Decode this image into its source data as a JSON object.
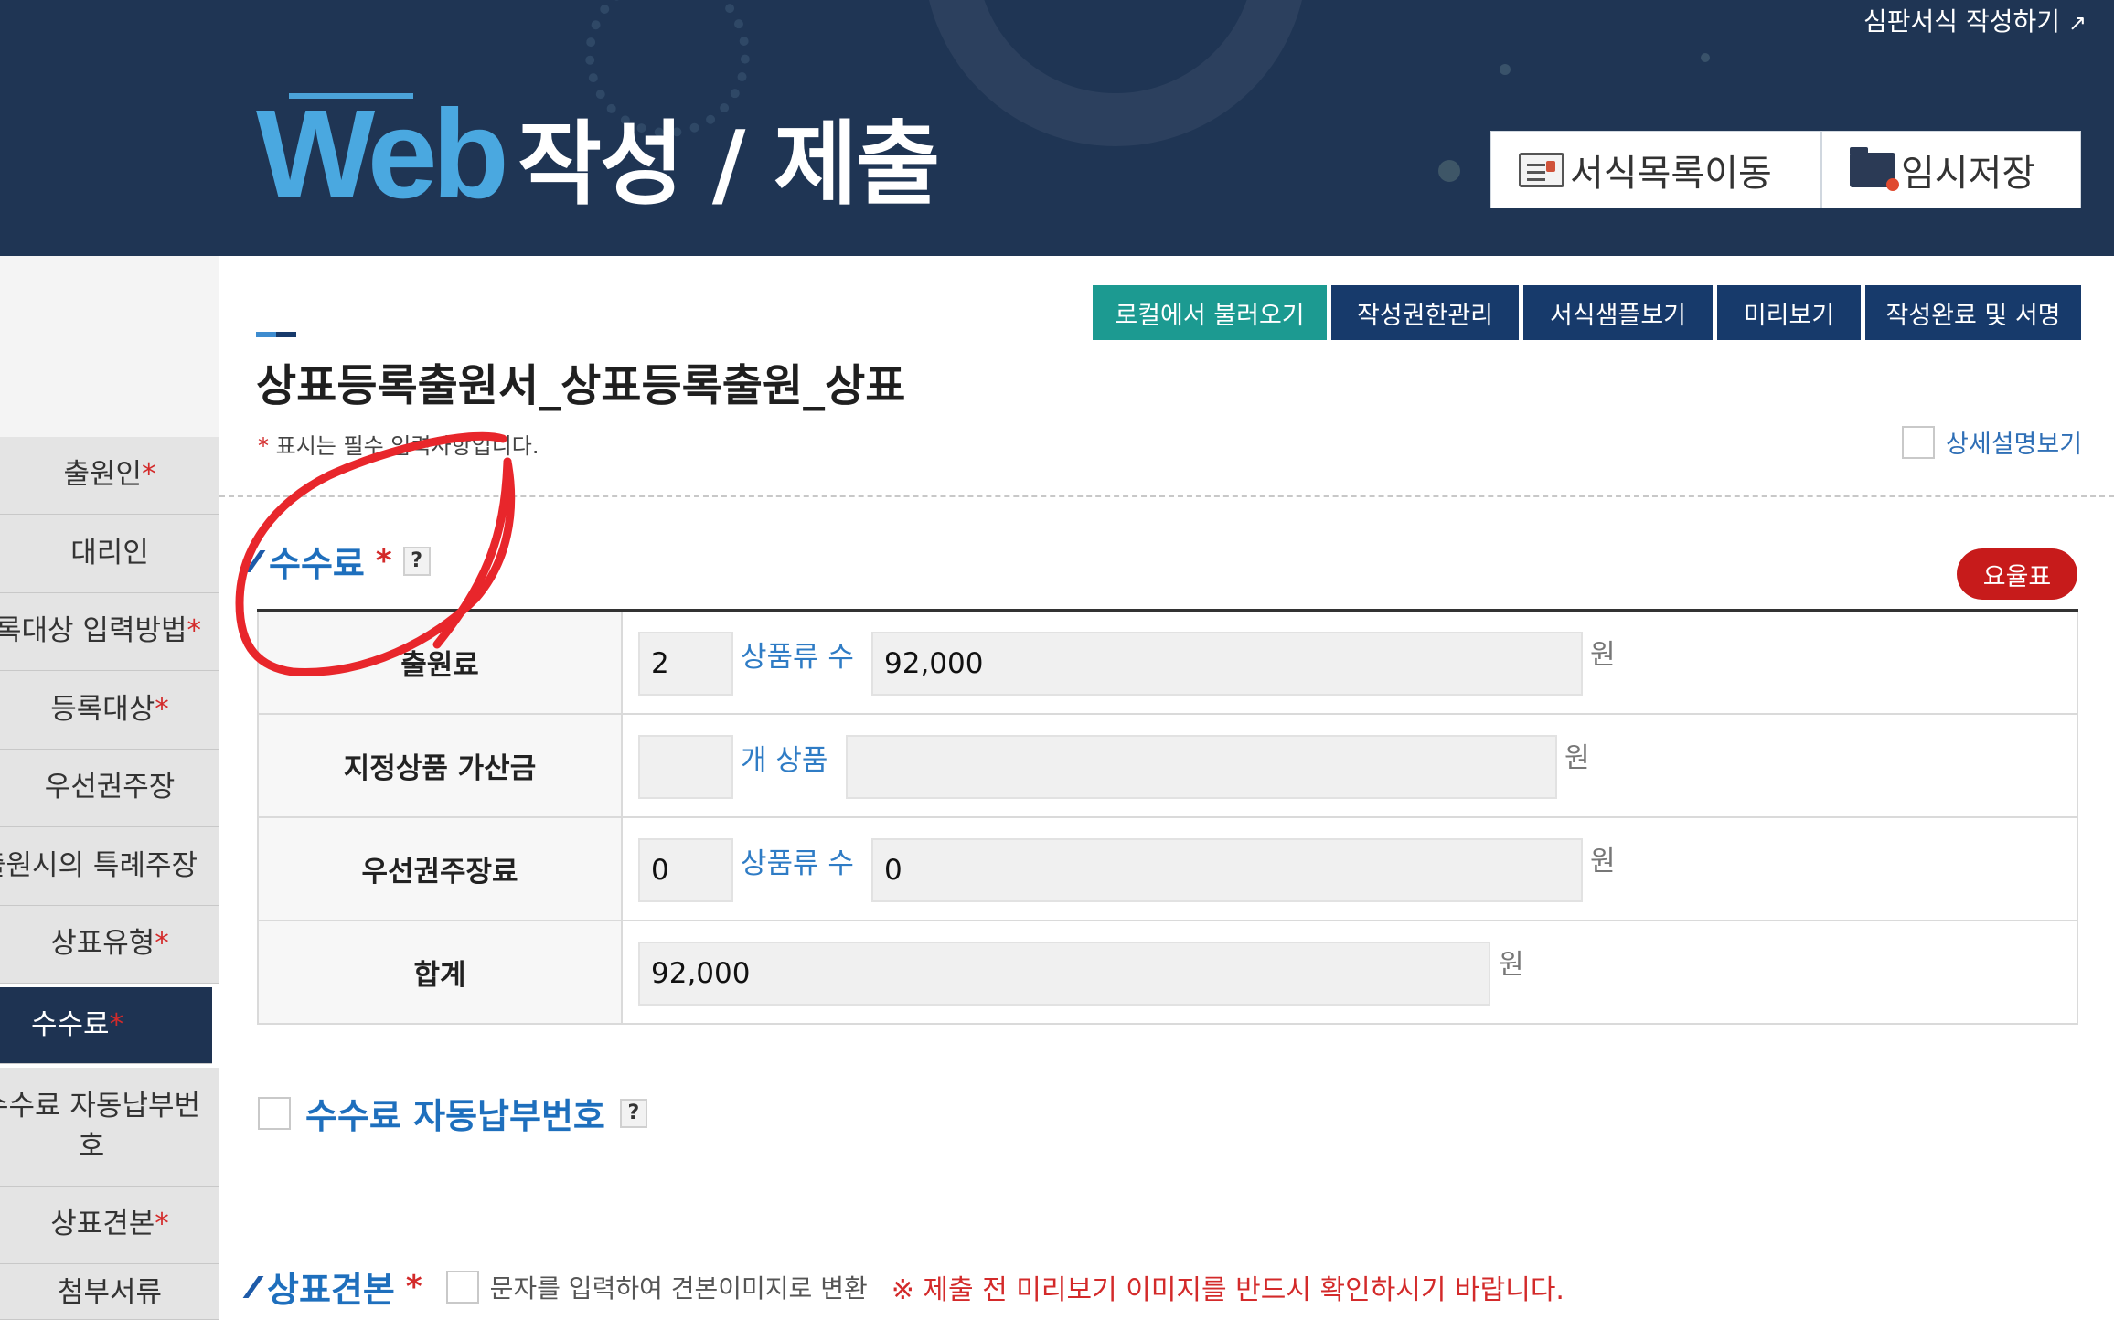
{
  "header": {
    "title_web": "Web",
    "title_rest": "작성 / 제출",
    "top_link": "심판서식 작성하기",
    "btn_form_list": "서식목록이동",
    "btn_temp_save": "임시저장"
  },
  "actions": {
    "load_local": "로컬에서 불러오기",
    "permission": "작성권한관리",
    "sample": "서식샘플보기",
    "preview": "미리보기",
    "complete": "작성완료 및 서명"
  },
  "page": {
    "title": "상표등록출원서_상표등록출원_상표",
    "required_note": "표시는 필수 입력사항입니다.",
    "detail_view": "상세설명보기"
  },
  "sidebar": {
    "items": [
      {
        "label": "출원인",
        "required": "*"
      },
      {
        "label": "대리인",
        "required": ""
      },
      {
        "label": "등록대상 입력방법",
        "required": "*"
      },
      {
        "label": "등록대상",
        "required": "*"
      },
      {
        "label": "우선권주장",
        "required": ""
      },
      {
        "label": "출원시의 특례주장",
        "required": ""
      },
      {
        "label": "상표유형",
        "required": "*"
      },
      {
        "label": "수수료",
        "required": "*"
      },
      {
        "label": "수수료 자동납부번호",
        "required": ""
      },
      {
        "label": "상표견본",
        "required": "*"
      },
      {
        "label": "첨부서류",
        "required": ""
      }
    ]
  },
  "fee_section": {
    "title": "수수료",
    "required": "*",
    "help": "?",
    "rate_button": "요율표",
    "rows": {
      "filing": {
        "label": "출원료",
        "count": "2",
        "unit": "상품류 수",
        "amount": "92,000",
        "won": "원"
      },
      "designated": {
        "label": "지정상품 가산금",
        "count": "",
        "unit": "개 상품",
        "amount": "",
        "won": "원"
      },
      "priority": {
        "label": "우선권주장료",
        "count": "0",
        "unit": "상품류 수",
        "amount": "0",
        "won": "원"
      },
      "total": {
        "label": "합계",
        "amount": "92,000",
        "won": "원"
      }
    }
  },
  "auto_pay": {
    "title": "수수료 자동납부번호",
    "help": "?"
  },
  "brand_sample": {
    "title": "상표견본",
    "required": "*",
    "convert_label": "문자를 입력하여 견본이미지로 변환",
    "warning": "※ 제출 전 미리보기 이미지를 반드시 확인하시기 바랍니다."
  },
  "colors": {
    "header_bg": "#1f3554",
    "accent_blue": "#4aa8e0",
    "teal_button": "#1c9a91",
    "navy_button": "#173a6b",
    "required_red": "#d32a2a",
    "annotation_red": "#e8262b"
  }
}
